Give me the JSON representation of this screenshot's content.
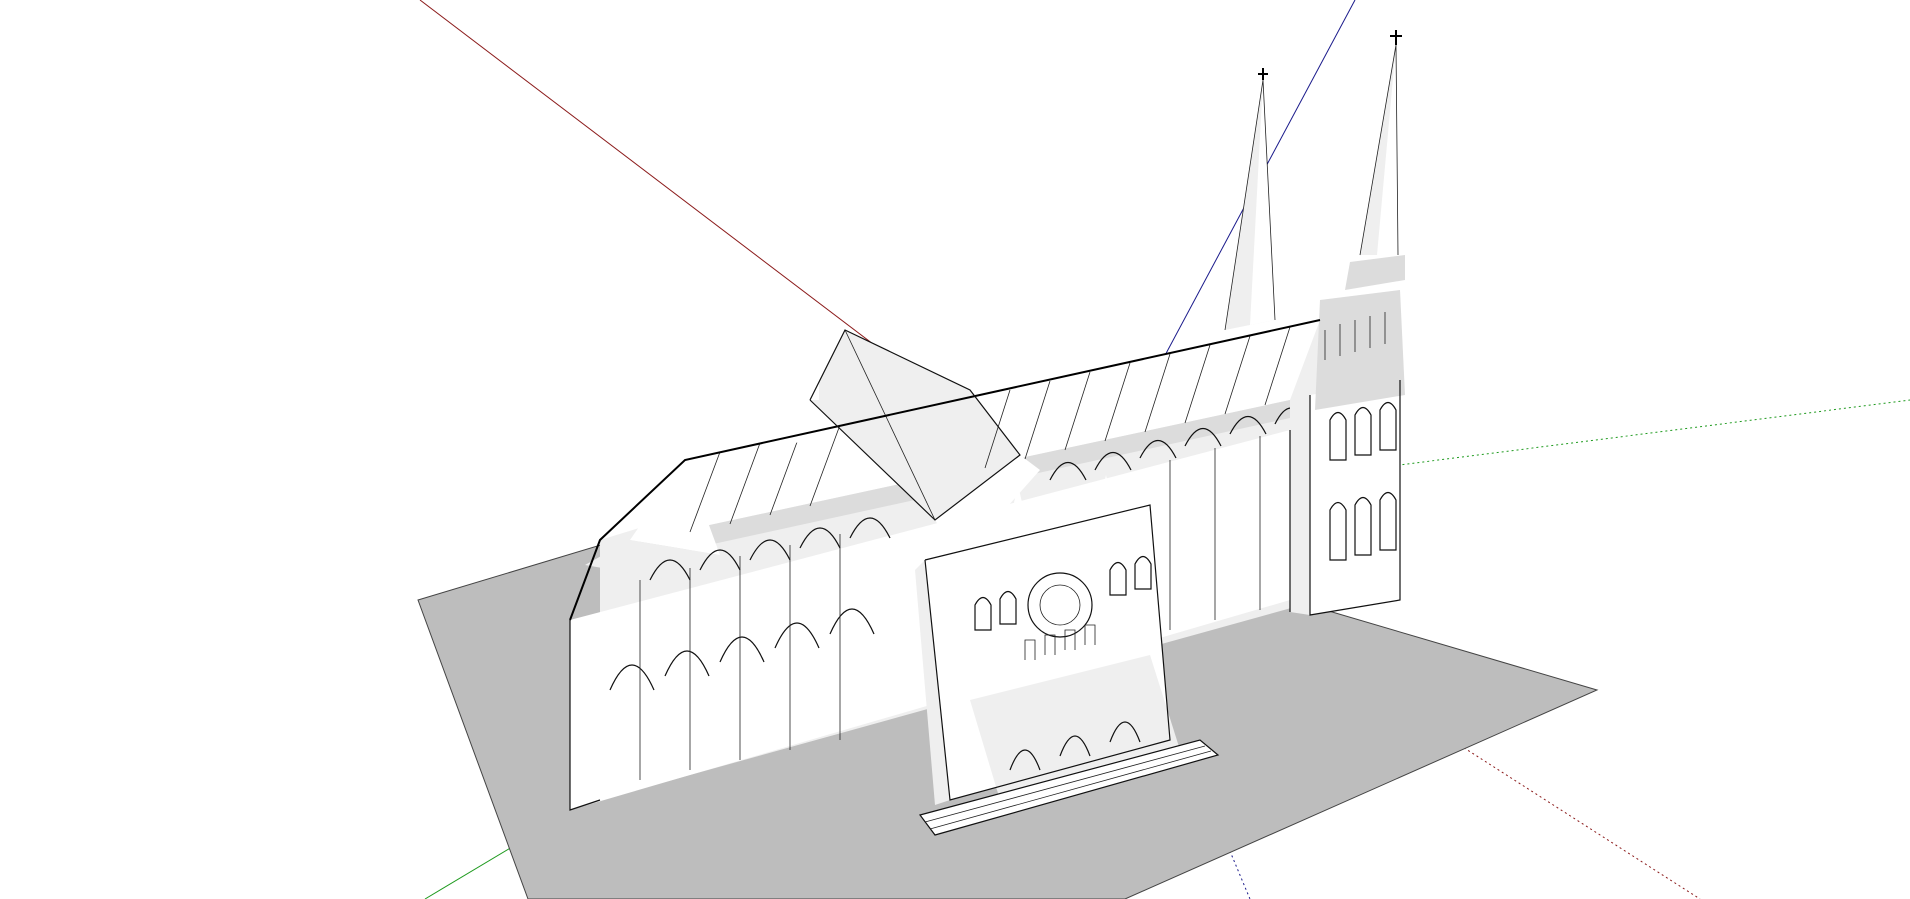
{
  "app": {
    "kind": "3d-modeling-viewport"
  },
  "scene": {
    "subject": "gothic-cathedral-model",
    "ground_color": "#bdbdbd",
    "background_color": "#ffffff",
    "axis_colors": {
      "red": "#8b1a1a",
      "green": "#1e9a1e",
      "blue": "#1a1a8b"
    },
    "axis_styles": {
      "positive": "solid",
      "negative": "dotted"
    }
  }
}
